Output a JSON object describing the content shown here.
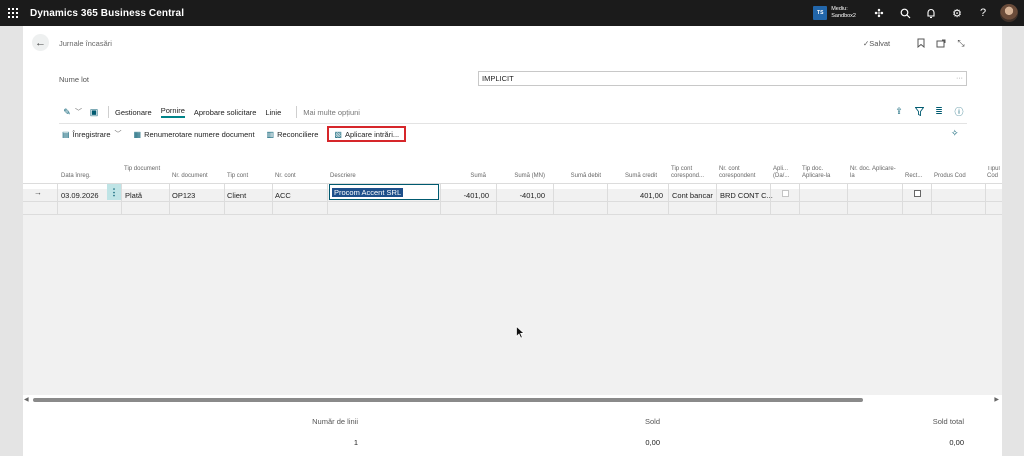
{
  "app": {
    "title": "Dynamics 365 Business Central"
  },
  "environment": {
    "badge": "TS",
    "line1": "Mediu:",
    "line2": "Sandbox2"
  },
  "page": {
    "breadcrumb": "Jurnale încasări",
    "saved": "✓Salvat",
    "lot_label": "Nume lot",
    "lot_value": "IMPLICIT"
  },
  "tabs": [
    "Gestionare",
    "Pornire",
    "Aprobare solicitare",
    "Linie"
  ],
  "more_options": "Mai multe opțiuni",
  "commands": {
    "post": "Înregistrare",
    "renumber": "Renumerotare numere document",
    "reconcile": "Reconciliere",
    "apply": "Aplicare intrări..."
  },
  "columns": [
    "Data înreg.",
    "Tip document",
    "Nr. document",
    "Tip cont",
    "Nr. cont",
    "Descriere",
    "Sumă",
    "Sumă (MN)",
    "Sumă debit",
    "Sumă credit",
    "Tip cont corespond...",
    "Nr. cont corespondent",
    "Apli... (Da/...",
    "Tip doc. Aplicare-la",
    "Nr. doc. Aplicare-la",
    "Rect...",
    "Produs Cod",
    "Tipul Cod"
  ],
  "row": {
    "date": "03.09.2026",
    "doc_type": "Plată",
    "doc_no": "OP123",
    "account_type": "Client",
    "account_no": "ACC",
    "description": "Procom Accent SRL",
    "amount": "-401,00",
    "amount_lcy": "-401,00",
    "debit": "",
    "credit": "401,00",
    "bal_account_type": "Cont bancar",
    "bal_account_no": "BRD CONT C..."
  },
  "totals": {
    "lines_label": "Număr de linii",
    "lines_value": "1",
    "balance_label": "Sold",
    "balance_value": "0,00",
    "total_balance_label": "Sold total",
    "total_balance_value": "0,00"
  }
}
